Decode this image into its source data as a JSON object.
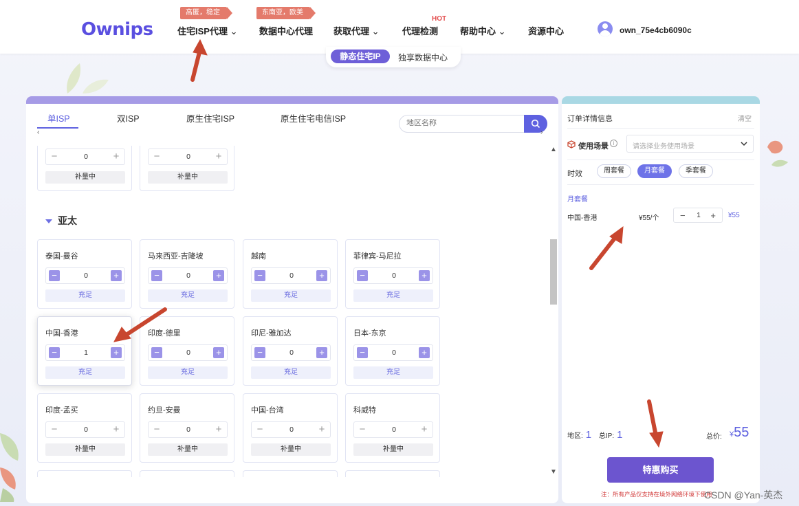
{
  "header": {
    "logo": "Ownips",
    "nav": [
      {
        "label": "住宅ISP代理",
        "chevron": true,
        "tag": "高匿，稳定"
      },
      {
        "label": "数据中心代理",
        "chevron": false,
        "tag": "东南亚，欧美"
      },
      {
        "label": "获取代理",
        "chevron": true
      },
      {
        "label": "代理检测",
        "chevron": false,
        "badge": "HOT"
      },
      {
        "label": "帮助中心",
        "chevron": true
      },
      {
        "label": "资源中心",
        "chevron": false
      }
    ],
    "username": "own_75e4cb6090c"
  },
  "subtabs": {
    "active": "静态住宅IP",
    "other": "独享数据中心"
  },
  "left": {
    "tabs": [
      "单ISP",
      "双ISP",
      "原生住宅ISP",
      "原生住宅电信ISP"
    ],
    "active_tab": "单ISP",
    "search_placeholder": "地区名称",
    "region": "亚太",
    "top_cards": [
      {
        "qty": "0",
        "status": "补量中"
      },
      {
        "qty": "0",
        "status": "补量中"
      }
    ],
    "cards": [
      {
        "name": "泰国-曼谷",
        "qty": "0",
        "status": "充足"
      },
      {
        "name": "马来西亚-吉隆坡",
        "qty": "0",
        "status": "充足"
      },
      {
        "name": "越南",
        "qty": "0",
        "status": "充足"
      },
      {
        "name": "菲律宾-马尼拉",
        "qty": "0",
        "status": "充足"
      },
      {
        "name": "中国-香港",
        "qty": "1",
        "status": "充足"
      },
      {
        "name": "印度-德里",
        "qty": "0",
        "status": "充足"
      },
      {
        "name": "印尼-雅加达",
        "qty": "0",
        "status": "充足"
      },
      {
        "name": "日本-东京",
        "qty": "0",
        "status": "充足"
      },
      {
        "name": "印度-孟买",
        "qty": "0",
        "status": "补量中"
      },
      {
        "name": "约旦-安曼",
        "qty": "0",
        "status": "补量中"
      },
      {
        "name": "中国-台湾",
        "qty": "0",
        "status": "补量中"
      },
      {
        "name": "科威特",
        "qty": "0",
        "status": "补量中"
      }
    ]
  },
  "right": {
    "title": "订单详情信息",
    "clear": "清空",
    "scene_label": "使用场景",
    "scene_placeholder": "请选择业务使用场景",
    "period_label": "时效",
    "periods": [
      "周套餐",
      "月套餐",
      "季套餐"
    ],
    "active_period": "月套餐",
    "section": "月套餐",
    "item": {
      "name": "中国-香港",
      "price": "¥55/个",
      "qty": "1",
      "total": "¥55"
    },
    "region_label": "地区:",
    "region_count": "1",
    "ip_label": "总IP:",
    "ip_count": "1",
    "total_label": "总价:",
    "total_currency": "¥",
    "total_value": "55",
    "buy_label": "特惠购买",
    "note": "注：所有产品仅支持在境外网络环境下使用"
  },
  "watermark": "CSDN @Yan-英杰",
  "colors": {
    "accent": "#5e61e0",
    "button": "#6c55cf",
    "arrow": "#c8462f",
    "tag": "#e47a6b"
  }
}
